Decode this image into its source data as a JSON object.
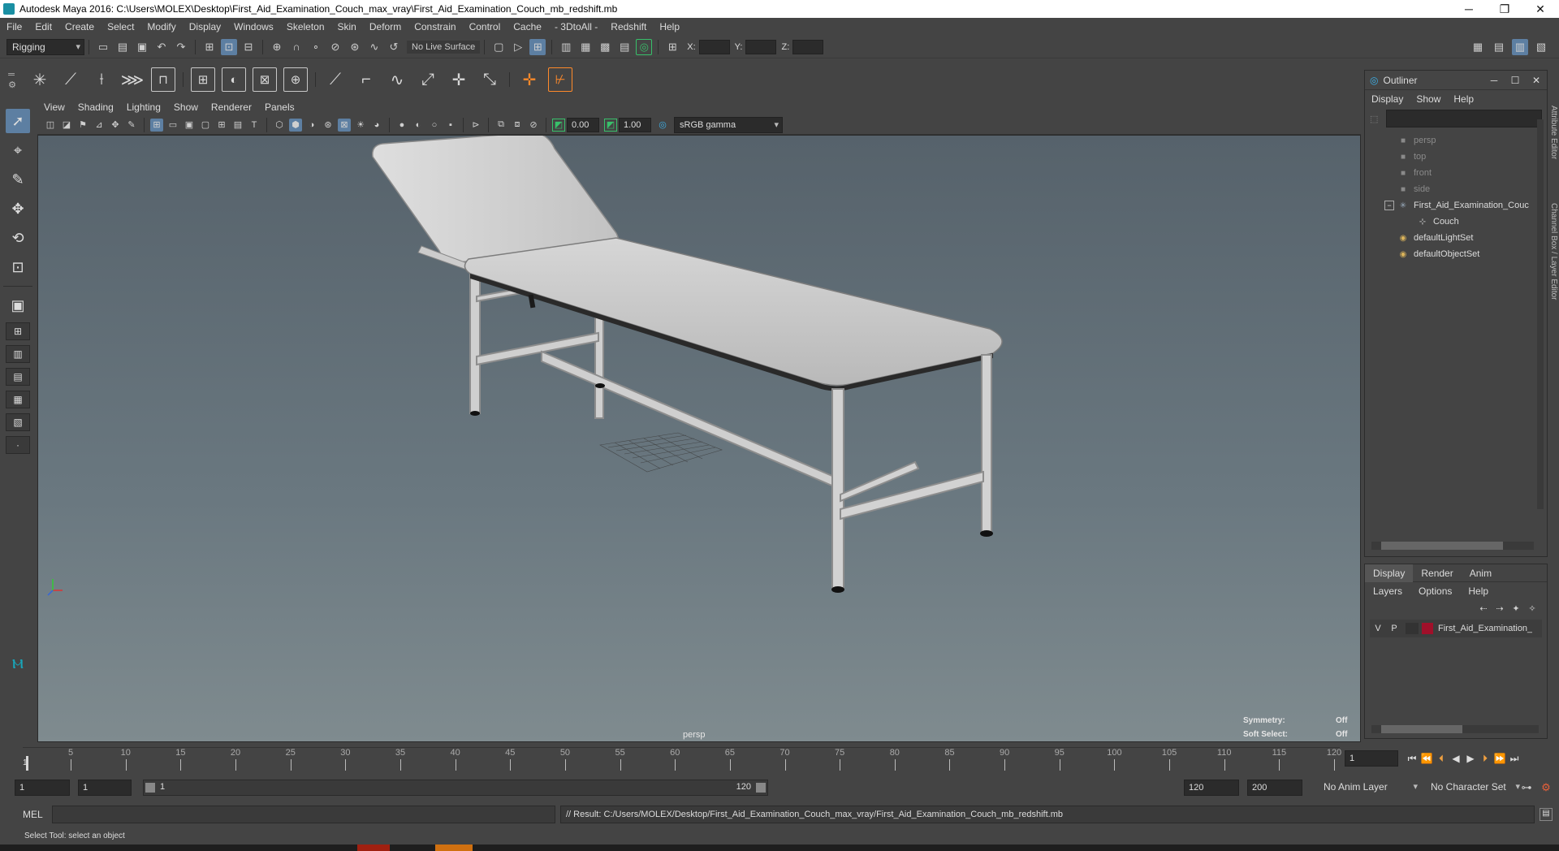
{
  "window": {
    "title": "Autodesk Maya 2016: C:\\Users\\MOLEX\\Desktop\\First_Aid_Examination_Couch_max_vray\\First_Aid_Examination_Couch_mb_redshift.mb",
    "min": "─",
    "restore": "❐",
    "close": "✕"
  },
  "menubar": [
    "File",
    "Edit",
    "Create",
    "Select",
    "Modify",
    "Display",
    "Windows",
    "Skeleton",
    "Skin",
    "Deform",
    "Constrain",
    "Control",
    "Cache",
    "- 3DtoAll -",
    "Redshift",
    "Help"
  ],
  "statusline": {
    "mode": "Rigging",
    "live_surface": "No Live Surface",
    "x_label": "X:",
    "y_label": "Y:",
    "z_label": "Z:"
  },
  "viewport": {
    "menu": [
      "View",
      "Shading",
      "Lighting",
      "Show",
      "Renderer",
      "Panels"
    ],
    "exposure": "0.00",
    "gamma": "1.00",
    "color_space": "sRGB gamma",
    "camera_label": "persp",
    "symmetry_label": "Symmetry:",
    "symmetry_value": "Off",
    "soft_select_label": "Soft Select:",
    "soft_select_value": "Off"
  },
  "outliner": {
    "title": "Outliner",
    "menu": [
      "Display",
      "Show",
      "Help"
    ],
    "items": [
      {
        "label": "persp",
        "icon": "camera-icon"
      },
      {
        "label": "top",
        "icon": "camera-icon"
      },
      {
        "label": "front",
        "icon": "camera-icon"
      },
      {
        "label": "side",
        "icon": "camera-icon"
      },
      {
        "label": "First_Aid_Examination_Couc",
        "icon": "group-icon"
      },
      {
        "label": "Couch",
        "icon": "mesh-icon"
      },
      {
        "label": "defaultLightSet",
        "icon": "set-icon"
      },
      {
        "label": "defaultObjectSet",
        "icon": "set-icon"
      }
    ]
  },
  "side_tabs": [
    "Attribute Editor",
    "Channel Box / Layer Editor"
  ],
  "layer_editor": {
    "tabs": [
      "Display",
      "Render",
      "Anim"
    ],
    "menu": [
      "Layers",
      "Options",
      "Help"
    ],
    "layer": {
      "v": "V",
      "p": "P",
      "name": "First_Aid_Examination_",
      "color": "#a0102a"
    }
  },
  "timeslider": {
    "labels": [
      "5",
      "10",
      "15",
      "20",
      "25",
      "30",
      "35",
      "40",
      "45",
      "50",
      "55",
      "60",
      "65",
      "70",
      "75",
      "80",
      "85",
      "90",
      "95",
      "100",
      "105",
      "110",
      "115",
      "120"
    ],
    "start_marker": "1",
    "current_frame": "1"
  },
  "rangeslider": {
    "start": "1",
    "range_start": "1",
    "range_bar_start": "1",
    "range_bar_end": "120",
    "playback_end": "120",
    "end": "200",
    "anim_layer": "No Anim Layer",
    "char_set": "No Character Set"
  },
  "cmdline": {
    "lang": "MEL",
    "result": "// Result: C:/Users/MOLEX/Desktop/First_Aid_Examination_Couch_max_vray/First_Aid_Examination_Couch_mb_redshift.mb"
  },
  "helpline": "Select Tool: select an object"
}
